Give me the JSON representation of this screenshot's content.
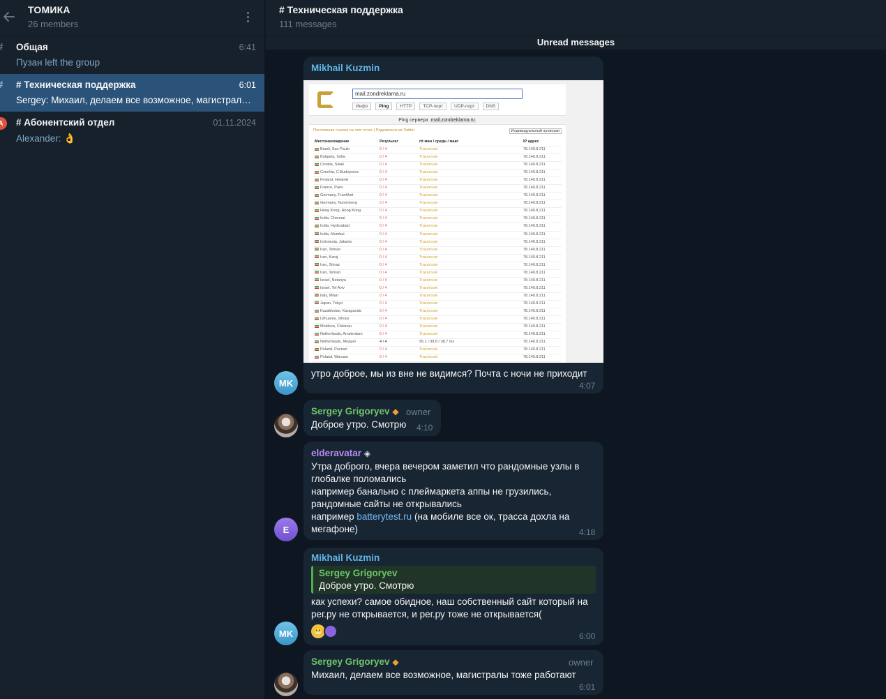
{
  "sidebar": {
    "title": "ТОМИКА",
    "subtitle": "26 members",
    "topics": [
      {
        "name": "Общая",
        "time": "6:41",
        "preview": "Пузан left the group",
        "icon": "#"
      },
      {
        "name": "# Техническая поддержка",
        "time": "6:01",
        "preview": "Sergey: Михаил, делаем все возможное, магистралы тоже работают",
        "icon": "#"
      },
      {
        "name": "# Абонентский отдел",
        "time": "01.11.2024",
        "preview_sender": "Alexander:",
        "preview_emoji": "👌",
        "icon": "A"
      }
    ]
  },
  "chat": {
    "title": "# Техническая поддержка",
    "subtitle": "111 messages",
    "unread_label": "Unread messages"
  },
  "messages": [
    {
      "sender": "Mikhail Kuzmin",
      "avatar": "MK",
      "text": "утро доброе, мы из вне не видимся? Почта с ночи не приходит",
      "time": "4:07",
      "screenshot": {
        "url": "mail.zondreklama.ru",
        "tabs": [
          "Инфо",
          "Ping",
          "HTTP",
          "TCP-порт",
          "UDP-порт",
          "DNS"
        ],
        "bar_label": "Ping сервера",
        "bar_host": "mail.zondreklama.ru",
        "note": "Постоянная ссылка на этот отчет | Поделиться на Twitter",
        "button": "Индивидуальный проверки",
        "headers": [
          "Местонахождение",
          "Результат",
          "rtt мин / средн / макс",
          "IP адрес"
        ],
        "rows": [
          [
            "Brazil, Sao Paulo",
            "0 / 4",
            "Traceroute",
            "78.140.8.211"
          ],
          [
            "Bulgaria, Sofia",
            "0 / 4",
            "Traceroute",
            "78.140.8.211"
          ],
          [
            "Croatia, Sisak",
            "0 / 4",
            "Traceroute",
            "78.140.8.211"
          ],
          [
            "Czechia, C.Budejovice",
            "0 / 4",
            "Traceroute",
            "78.140.8.211"
          ],
          [
            "Finland, Helsinki",
            "0 / 4",
            "Traceroute",
            "78.140.8.211"
          ],
          [
            "France, Paris",
            "0 / 4",
            "Traceroute",
            "78.140.8.211"
          ],
          [
            "Germany, Frankfurt",
            "0 / 4",
            "Traceroute",
            "78.140.8.211"
          ],
          [
            "Germany, Nuremberg",
            "0 / 4",
            "Traceroute",
            "78.140.8.211"
          ],
          [
            "Hong Kong, Hong Kong",
            "0 / 4",
            "Traceroute",
            "78.140.8.211"
          ],
          [
            "India, Chennai",
            "0 / 4",
            "Traceroute",
            "78.140.8.211"
          ],
          [
            "India, Hyderabad",
            "0 / 4",
            "Traceroute",
            "78.140.8.211"
          ],
          [
            "India, Mumbai",
            "0 / 4",
            "Traceroute",
            "78.140.8.211"
          ],
          [
            "Indonesia, Jakarta",
            "0 / 4",
            "Traceroute",
            "78.140.8.211"
          ],
          [
            "Iran, Tehran",
            "0 / 4",
            "Traceroute",
            "78.140.8.211"
          ],
          [
            "Iran, Karaj",
            "0 / 4",
            "Traceroute",
            "78.140.8.211"
          ],
          [
            "Iran, Shiraz",
            "0 / 4",
            "Traceroute",
            "78.140.8.211"
          ],
          [
            "Iran, Tehran",
            "0 / 4",
            "Traceroute",
            "78.140.8.211"
          ],
          [
            "Israel, Netanya",
            "0 / 4",
            "Traceroute",
            "78.140.8.211"
          ],
          [
            "Israel, Tel Aviv",
            "0 / 4",
            "Traceroute",
            "78.140.8.211"
          ],
          [
            "Italy, Milan",
            "0 / 4",
            "Traceroute",
            "78.140.8.211"
          ],
          [
            "Japan, Tokyo",
            "0 / 4",
            "Traceroute",
            "78.140.8.211"
          ],
          [
            "Kazakhstan, Karaganda",
            "0 / 4",
            "Traceroute",
            "78.140.8.211"
          ],
          [
            "Lithuania, Vilnius",
            "0 / 4",
            "Traceroute",
            "78.140.8.211"
          ],
          [
            "Moldova, Chisinau",
            "0 / 4",
            "Traceroute",
            "78.140.8.211"
          ],
          [
            "Netherlands, Amsterdam",
            "0 / 4",
            "Traceroute",
            "78.140.8.211"
          ],
          [
            "Netherlands, Meppel",
            "4 / 4",
            "95.1 / 98.8 / 38.7 ms",
            "78.140.8.211"
          ],
          [
            "Poland, Poznan",
            "0 / 4",
            "Traceroute",
            "78.140.8.211"
          ],
          [
            "Poland, Warsaw",
            "0 / 4",
            "Traceroute",
            "78.140.8.211"
          ]
        ]
      }
    },
    {
      "sender": "Sergey Grigoryev",
      "badge": "owner",
      "text": "Доброе утро. Смотрю",
      "time": "4:10"
    },
    {
      "sender": "elderavatar",
      "avatar": "E",
      "text_lines": [
        "Утра доброго, вчера вечером заметил что рандомные узлы в",
        "глобалке поломались",
        "например банально с плеймаркета аппы не грузились,",
        "рандомные сайты не открывались"
      ],
      "text_prefix": "например",
      "link": "batterytest.ru",
      "text_suffix": "(на мобиле все ок, трасса дохла на",
      "text_last": "мегафоне)",
      "time": "4:18"
    },
    {
      "sender": "Mikhail Kuzmin",
      "avatar": "MK",
      "reply_sender": "Sergey Grigoryev",
      "reply_text": "Доброе утро. Смотрю",
      "text_lines": [
        "как успехи? самое обидное, наш собственный сайт который на",
        "рег.ру не открывается, и рег.ру тоже не открывается("
      ],
      "reaction": "😬",
      "time": "6:00"
    },
    {
      "sender": "Sergey Grigoryev",
      "badge": "owner",
      "text": "Михаил, делаем все возможное, магистралы тоже работают",
      "time": "6:01"
    }
  ],
  "colors": {
    "sidebar_bg": "#17212b",
    "chat_bg": "#0e1621",
    "bubble_bg": "#182533",
    "active_topic": "#2b5278",
    "name_blue": "#5fb6e6",
    "name_green": "#6fc56a",
    "name_purple": "#b78cf5"
  }
}
